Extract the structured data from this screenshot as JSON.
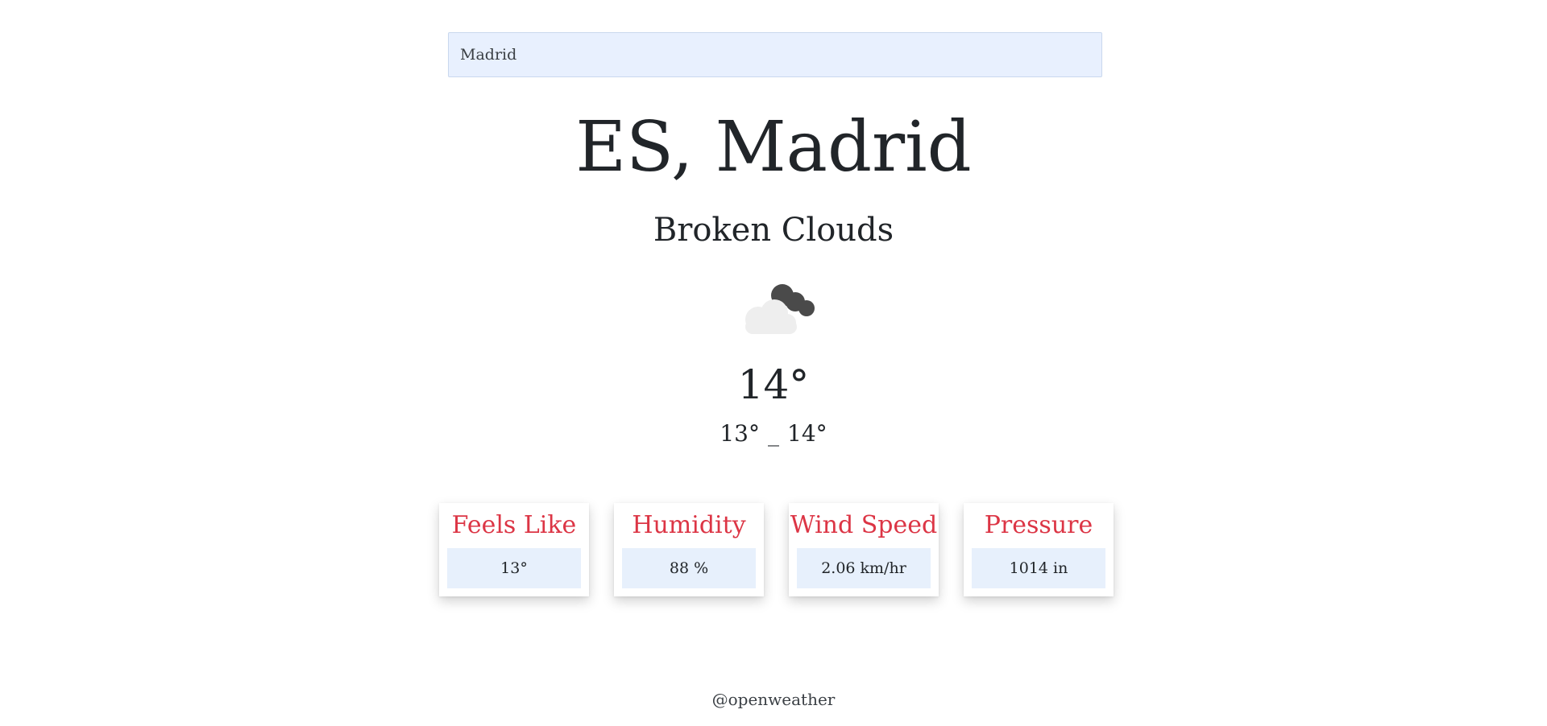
{
  "search": {
    "value": "Madrid",
    "placeholder": ""
  },
  "location": {
    "country": "ES",
    "city": "Madrid",
    "display": "ES, Madrid"
  },
  "weather": {
    "description": "Broken Clouds",
    "icon": "broken-clouds-icon",
    "temperature": "14°",
    "temp_min": "13°",
    "range_separator": "_",
    "temp_max": "14°"
  },
  "details": [
    {
      "label": "Feels Like",
      "value": "13°"
    },
    {
      "label": "Humidity",
      "value": "88 %"
    },
    {
      "label": "Wind Speed",
      "value": "2.06 km/hr"
    },
    {
      "label": "Pressure",
      "value": "1014 in"
    }
  ],
  "footer": {
    "credit": "@openweather"
  },
  "colors": {
    "accent": "#dc3545",
    "value_bg": "#e7f0fc",
    "search_bg": "#e8f0fe",
    "text": "#212529"
  }
}
